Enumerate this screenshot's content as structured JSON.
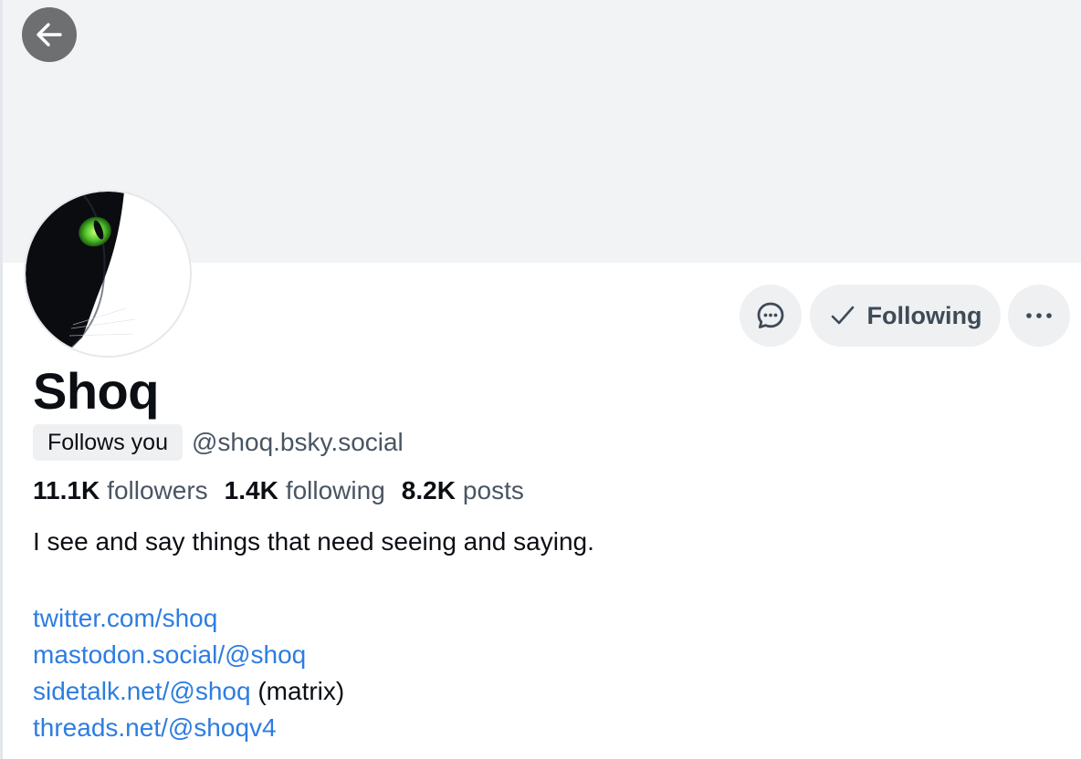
{
  "profile": {
    "display_name": "Shoq",
    "follows_you_label": "Follows you",
    "handle": "@shoq.bsky.social",
    "bio": "I see and say things that need seeing and saying."
  },
  "stats": {
    "followers_count": "11.1K",
    "followers_label": "followers",
    "following_count": "1.4K",
    "following_label": "following",
    "posts_count": "8.2K",
    "posts_label": "posts"
  },
  "actions": {
    "following_label": "Following",
    "message_icon": "message-bubble-icon",
    "more_icon": "ellipsis-icon",
    "check_icon": "check-icon"
  },
  "links": [
    {
      "text": "twitter.com/shoq",
      "suffix": ""
    },
    {
      "text": "mastodon.social/@shoq",
      "suffix": ""
    },
    {
      "text": "sidetalk.net/@shoq",
      "suffix": " (matrix)"
    },
    {
      "text": "threads.net/@shoqv4",
      "suffix": ""
    }
  ],
  "colors": {
    "link": "#2d7de0",
    "banner": "#f1f3f5",
    "button_bg": "#eef0f2",
    "back_button": "#6e6f70"
  }
}
